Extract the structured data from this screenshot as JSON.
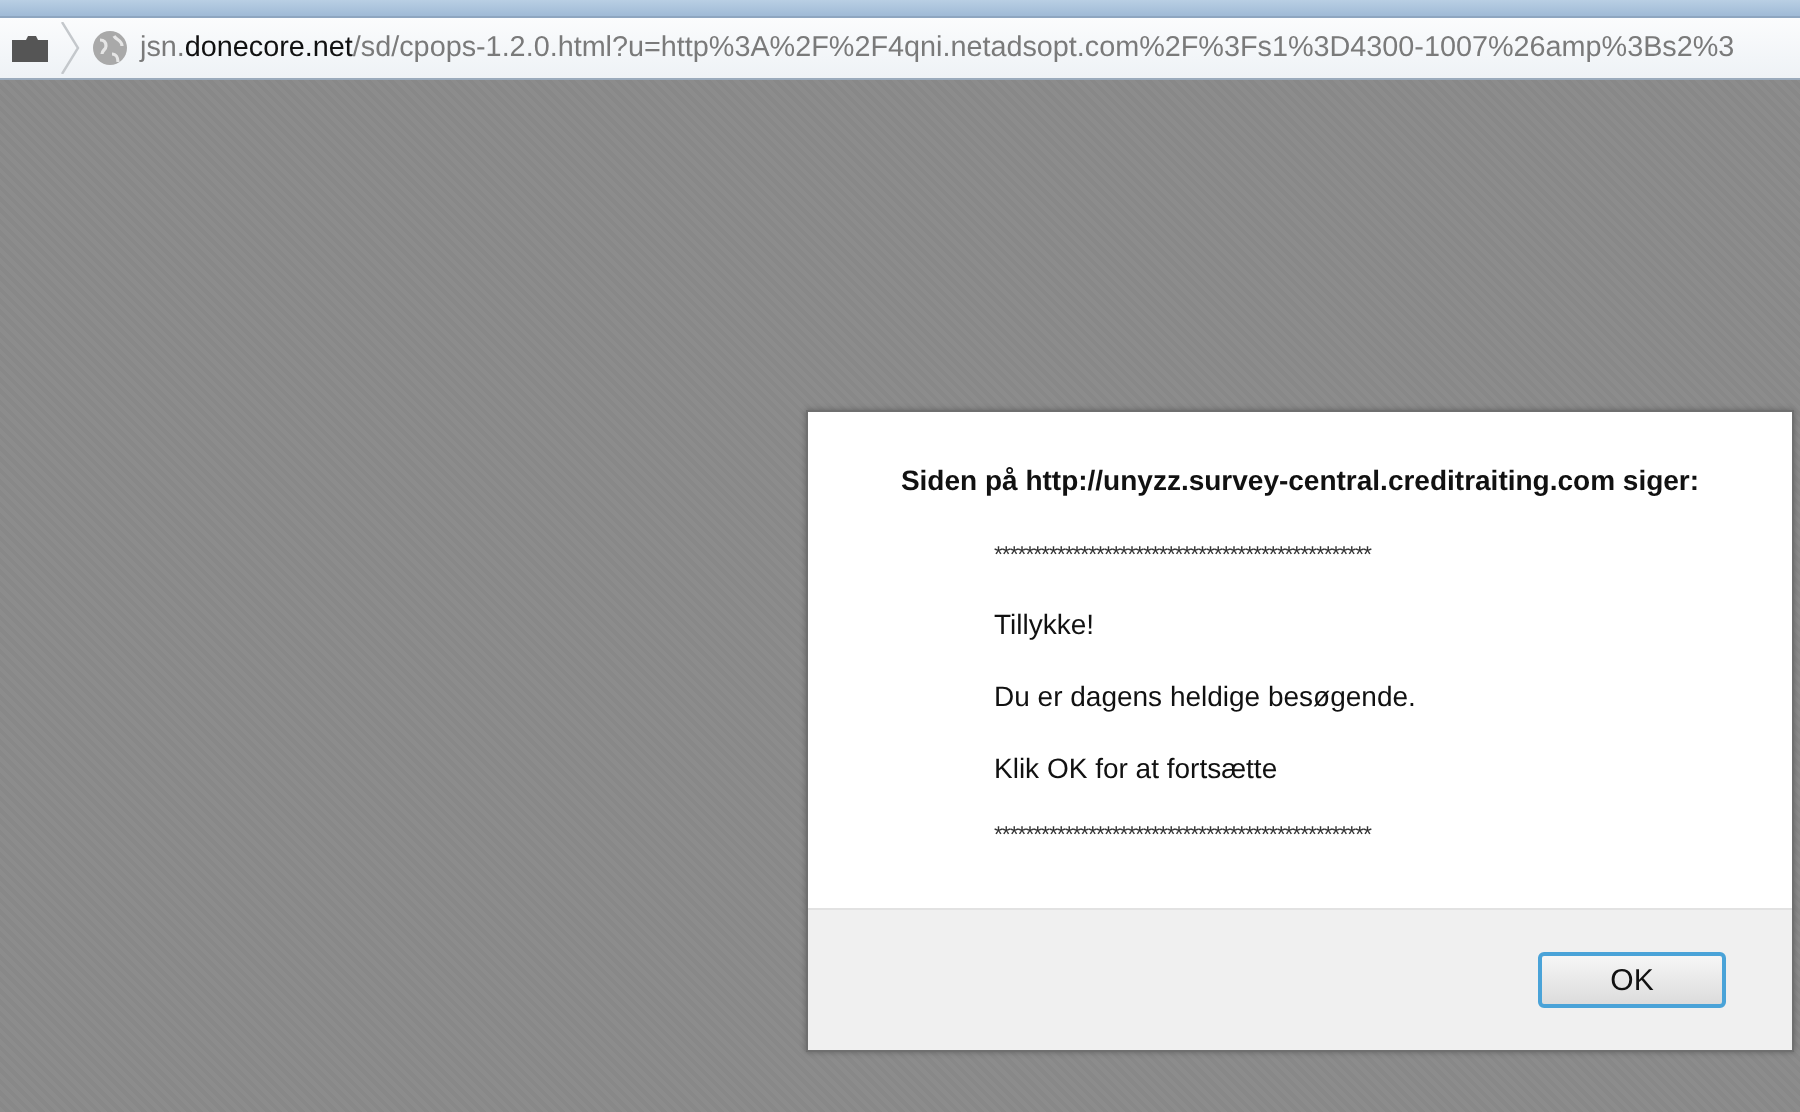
{
  "address_bar": {
    "url_parts": [
      {
        "text": "jsn.",
        "kind": "plain"
      },
      {
        "text": "donecore.net",
        "kind": "domain"
      },
      {
        "text": "/sd/cpops-1.2.0.html?u=http%3A%2F%2F4qni.netadsopt.com%2F%3Fs1%3D4300-1007%26amp%3Bs2%3",
        "kind": "plain"
      }
    ]
  },
  "dialog": {
    "title": "Siden på http://unyzz.survey-central.creditraiting.com siger:",
    "lines": [
      {
        "text": "************************************************",
        "kind": "separator"
      },
      {
        "text": "Tillykke!",
        "kind": "text"
      },
      {
        "text": "Du er dagens heldige besøgende.",
        "kind": "text"
      },
      {
        "text": "Klik OK for at fortsætte",
        "kind": "text"
      },
      {
        "text": "************************************************",
        "kind": "separator"
      }
    ],
    "buttons": [
      "OK"
    ]
  }
}
